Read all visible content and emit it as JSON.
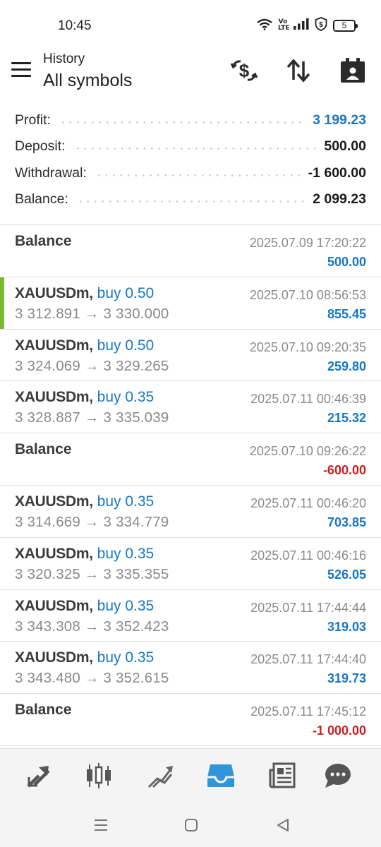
{
  "status": {
    "time": "10:45",
    "volte_label": "Vo LTE",
    "battery_level": "5"
  },
  "toolbar": {
    "subtitle": "History",
    "title": "All symbols",
    "icons": [
      "currency-exchange-icon",
      "sort-icon",
      "calendar-icon"
    ]
  },
  "summary": {
    "profit_label": "Profit:",
    "profit_value": "3 199.23",
    "deposit_label": "Deposit:",
    "deposit_value": "500.00",
    "withdrawal_label": "Withdrawal:",
    "withdrawal_value": "-1 600.00",
    "balance_label": "Balance:",
    "balance_value": "2 099.23"
  },
  "rows": [
    {
      "type": "balance",
      "title": "Balance",
      "date": "2025.07.09 17:20:22",
      "amount": "500.00",
      "sign": "pos"
    },
    {
      "type": "trade",
      "symbol": "XAUUSDm,",
      "side": "buy 0.50",
      "prices": "3 312.891 → 3 330.000",
      "date": "2025.07.10 08:56:53",
      "amount": "855.45",
      "sign": "pos",
      "highlighted": true
    },
    {
      "type": "trade",
      "symbol": "XAUUSDm,",
      "side": "buy 0.50",
      "prices": "3 324.069 → 3 329.265",
      "date": "2025.07.10 09:20:35",
      "amount": "259.80",
      "sign": "pos"
    },
    {
      "type": "trade",
      "symbol": "XAUUSDm,",
      "side": "buy 0.35",
      "prices": "3 328.887 → 3 335.039",
      "date": "2025.07.11 00:46:39",
      "amount": "215.32",
      "sign": "pos"
    },
    {
      "type": "balance",
      "title": "Balance",
      "date": "2025.07.10 09:26:22",
      "amount": "-600.00",
      "sign": "neg"
    },
    {
      "type": "trade",
      "symbol": "XAUUSDm,",
      "side": "buy 0.35",
      "prices": "3 314.669 → 3 334.779",
      "date": "2025.07.11 00:46:20",
      "amount": "703.85",
      "sign": "pos"
    },
    {
      "type": "trade",
      "symbol": "XAUUSDm,",
      "side": "buy 0.35",
      "prices": "3 320.325 → 3 335.355",
      "date": "2025.07.11 00:46:16",
      "amount": "526.05",
      "sign": "pos"
    },
    {
      "type": "trade",
      "symbol": "XAUUSDm,",
      "side": "buy 0.35",
      "prices": "3 343.308 → 3 352.423",
      "date": "2025.07.11 17:44:44",
      "amount": "319.03",
      "sign": "pos"
    },
    {
      "type": "trade",
      "symbol": "XAUUSDm,",
      "side": "buy 0.35",
      "prices": "3 343.480 → 3 352.615",
      "date": "2025.07.11 17:44:40",
      "amount": "319.73",
      "sign": "pos"
    },
    {
      "type": "balance",
      "title": "Balance",
      "date": "2025.07.11 17:45:12",
      "amount": "-1 000.00",
      "sign": "neg"
    }
  ],
  "bottom_nav": {
    "items": [
      "quotes-icon",
      "chart-icon",
      "trade-icon",
      "history-icon",
      "news-icon",
      "chat-icon"
    ],
    "active": "history-icon"
  },
  "colors": {
    "accent_blue": "#1777c4",
    "negative_red": "#cc1f1f",
    "profit_marker_green": "#7cb82f",
    "active_nav": "#2f95dc"
  }
}
